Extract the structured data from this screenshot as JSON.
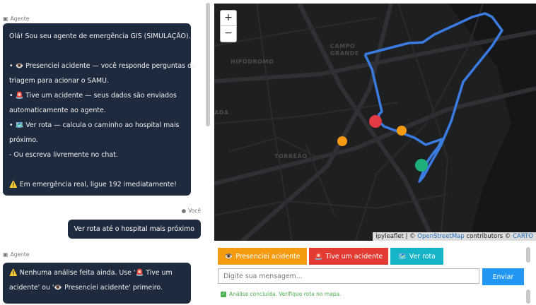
{
  "chat": {
    "agent_label": "Agente",
    "user_label": "Você",
    "messages": {
      "welcome": {
        "line1": "Olá! Sou seu agente de emergência GIS (SIMULAÇÃO).",
        "line2_icon": "👁️",
        "line2": "Presenciei acidente — você responde perguntas de",
        "line3": "triagem para acionar o SAMU.",
        "line4_icon": "🚨",
        "line4": "Tive um acidente — seus dados são enviados",
        "line5": "automaticamente ao agente.",
        "line6_icon": "🗺️",
        "line6": "Ver rota — calcula o caminho ao hospital mais",
        "line7": "próximo.",
        "line8": "- Ou escreva livremente no chat.",
        "line9_icon": "⚠️",
        "line9": "Em emergência real, ligue 192 imediatamente!"
      },
      "user": "Ver rota até o hospital mais próximo",
      "reply": {
        "line1_a": "Nenhuma análise feita ainda. Use '",
        "line1_icon": "🚨",
        "line1_b": "Tive um",
        "line2_a": "acidente' ou '",
        "line2_icon": "👁️",
        "line2_b": "Presenciei acidente' primeiro."
      }
    }
  },
  "map": {
    "zoom_in": "+",
    "zoom_out": "−",
    "places": {
      "hipodromo": "HIPÓDROMO",
      "campo": "CAMPO",
      "grande": "GRANDE",
      "torreao": "TORREÃO",
      "ada": "ADA"
    },
    "attribution": {
      "prefix": "ipyleaflet | ©",
      "osm": "OpenStreetMap",
      "middle": "contributors ©",
      "carto": "CARTO"
    },
    "colors": {
      "route": "#3a7be0",
      "accident_marker": "#e23b45",
      "hospital_marker": "#1fb07a",
      "other_marker": "#f59b11"
    }
  },
  "controls": {
    "witness_button": "Presenciei acidente",
    "accident_button": "Tive um acidente",
    "route_button": "Ver rota",
    "message_placeholder": "Digite sua mensagem...",
    "send_button": "Enviar",
    "status": "Análise concluída. Verifique rota no mapa."
  }
}
